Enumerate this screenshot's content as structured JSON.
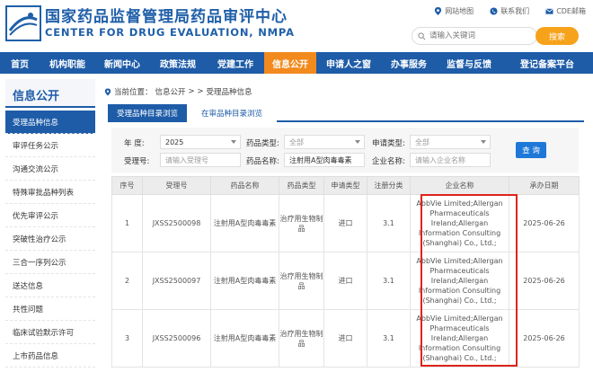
{
  "header": {
    "title_cn": "国家药品监督管理局药品审评中心",
    "title_en": "CENTER FOR DRUG EVALUATION, NMPA",
    "links": [
      {
        "label": "网站地图",
        "icon": "location-icon"
      },
      {
        "label": "联系我们",
        "icon": "phone-icon"
      },
      {
        "label": "CDE邮箱",
        "icon": "mail-icon"
      }
    ],
    "search_placeholder": "请输入关键词",
    "search_button": "搜索"
  },
  "nav": {
    "items": [
      {
        "label": "首页"
      },
      {
        "label": "机构职能"
      },
      {
        "label": "新闻中心"
      },
      {
        "label": "政策法规"
      },
      {
        "label": "党建工作"
      },
      {
        "label": "信息公开",
        "active": true
      },
      {
        "label": "申请人之窗"
      },
      {
        "label": "办事服务"
      },
      {
        "label": "监督与反馈"
      },
      {
        "label": "登记备案平台"
      }
    ]
  },
  "sidebar": {
    "title": "信息公开",
    "items": [
      {
        "label": "受理品种信息",
        "active": true
      },
      {
        "label": "审评任务公示"
      },
      {
        "label": "沟通交流公示"
      },
      {
        "label": "特殊审批品种列表"
      },
      {
        "label": "优先审评公示"
      },
      {
        "label": "突破性治疗公示"
      },
      {
        "label": "三合一序列公示"
      },
      {
        "label": "送达信息"
      },
      {
        "label": "共性问题"
      },
      {
        "label": "临床试验默示许可"
      },
      {
        "label": "上市药品信息"
      }
    ]
  },
  "breadcrumb": {
    "prefix": "当前位置：",
    "level1": "信息公开",
    "sep": "> >",
    "level2": "受理品种信息"
  },
  "tabs": [
    {
      "label": "受理品种目录浏览",
      "active": true
    },
    {
      "label": "在审品种目录浏览",
      "active": false
    }
  ],
  "filter": {
    "year_label": "年  度:",
    "year_value": "2025",
    "drug_type_label": "药品类型:",
    "drug_type_value": "全部",
    "apply_type_label": "申请类型:",
    "apply_type_value": "全部",
    "accept_no_label": "受理号:",
    "accept_no_placeholder": "请输入受理号",
    "drug_name_label": "药品名称:",
    "drug_name_value": "注射用A型肉毒毒素",
    "company_label": "企业名称:",
    "company_placeholder": "请输入企业名称",
    "query_button": "查 询"
  },
  "table": {
    "headers": [
      "序号",
      "受理号",
      "药品名称",
      "药品类型",
      "申请类型",
      "注册分类",
      "企业名称",
      "承办日期"
    ],
    "rows": [
      {
        "no": "1",
        "accept_no": "JXSS2500098",
        "drug_name": "注射用A型肉毒毒素",
        "drug_type": "治疗用生物制品",
        "apply_type": "进口",
        "reg_class": "3.1",
        "company": "AbbVie Limited;Allergan Pharmaceuticals Ireland;Allergan Information Consulting (Shanghai) Co., Ltd.;",
        "date": "2025-06-26"
      },
      {
        "no": "2",
        "accept_no": "JXSS2500097",
        "drug_name": "注射用A型肉毒毒素",
        "drug_type": "治疗用生物制品",
        "apply_type": "进口",
        "reg_class": "3.1",
        "company": "AbbVie Limited;Allergan Pharmaceuticals Ireland;Allergan Information Consulting (Shanghai) Co., Ltd.;",
        "date": "2025-06-26"
      },
      {
        "no": "3",
        "accept_no": "JXSS2500096",
        "drug_name": "注射用A型肉毒毒素",
        "drug_type": "治疗用生物制品",
        "apply_type": "进口",
        "reg_class": "3.1",
        "company": "AbbVie Limited;Allergan Pharmaceuticals Ireland;Allergan Information Consulting (Shanghai) Co., Ltd.;",
        "date": "2025-06-26"
      }
    ]
  },
  "colors": {
    "brand_blue": "#1e5ca8",
    "accent_orange": "#f28a1e",
    "highlight_red": "#e0231b"
  }
}
